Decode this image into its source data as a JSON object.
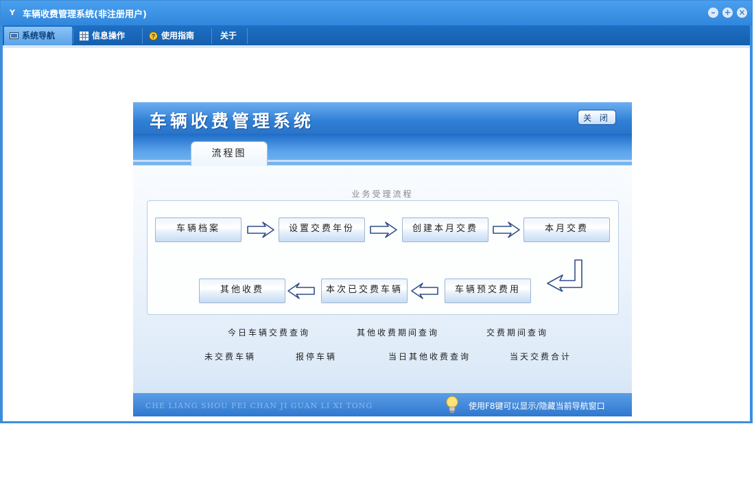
{
  "window": {
    "title": "车辆收费管理系统(非注册用户)",
    "app_icon": "Y"
  },
  "menu": [
    {
      "label": "系统导航",
      "icon": "monitor-icon"
    },
    {
      "label": "信息操作",
      "icon": "grid-icon"
    },
    {
      "label": "使用指南",
      "icon": "help-icon"
    },
    {
      "label": "关于"
    }
  ],
  "panel": {
    "title": "车辆收费管理系统",
    "close_label": "关 闭",
    "tab_label": "流程图",
    "flow_caption": "业务受理流程",
    "steps_row1": [
      "车辆档案",
      "设置交费年份",
      "创建本月交费",
      "本月交费"
    ],
    "steps_row2": [
      "车辆预交费用",
      "本次已交费车辆",
      "其他收费"
    ],
    "queries_row1": [
      "今日车辆交费查询",
      "其他收费期间查询",
      "交费期间查询"
    ],
    "queries_row2": [
      "未交费车辆",
      "报停车辆",
      "当日其他收费查询",
      "当天交费合计"
    ],
    "footer_english": "CHE LIANG SHOU FEI CHAN JI GUAN LI XI TONG",
    "footer_tip": "使用F8键可以显示/隐藏当前导航窗口"
  },
  "colors": {
    "accent": "#2f86dc",
    "menubar": "#1e6fc4",
    "active_tab": "#5aa3e8"
  }
}
